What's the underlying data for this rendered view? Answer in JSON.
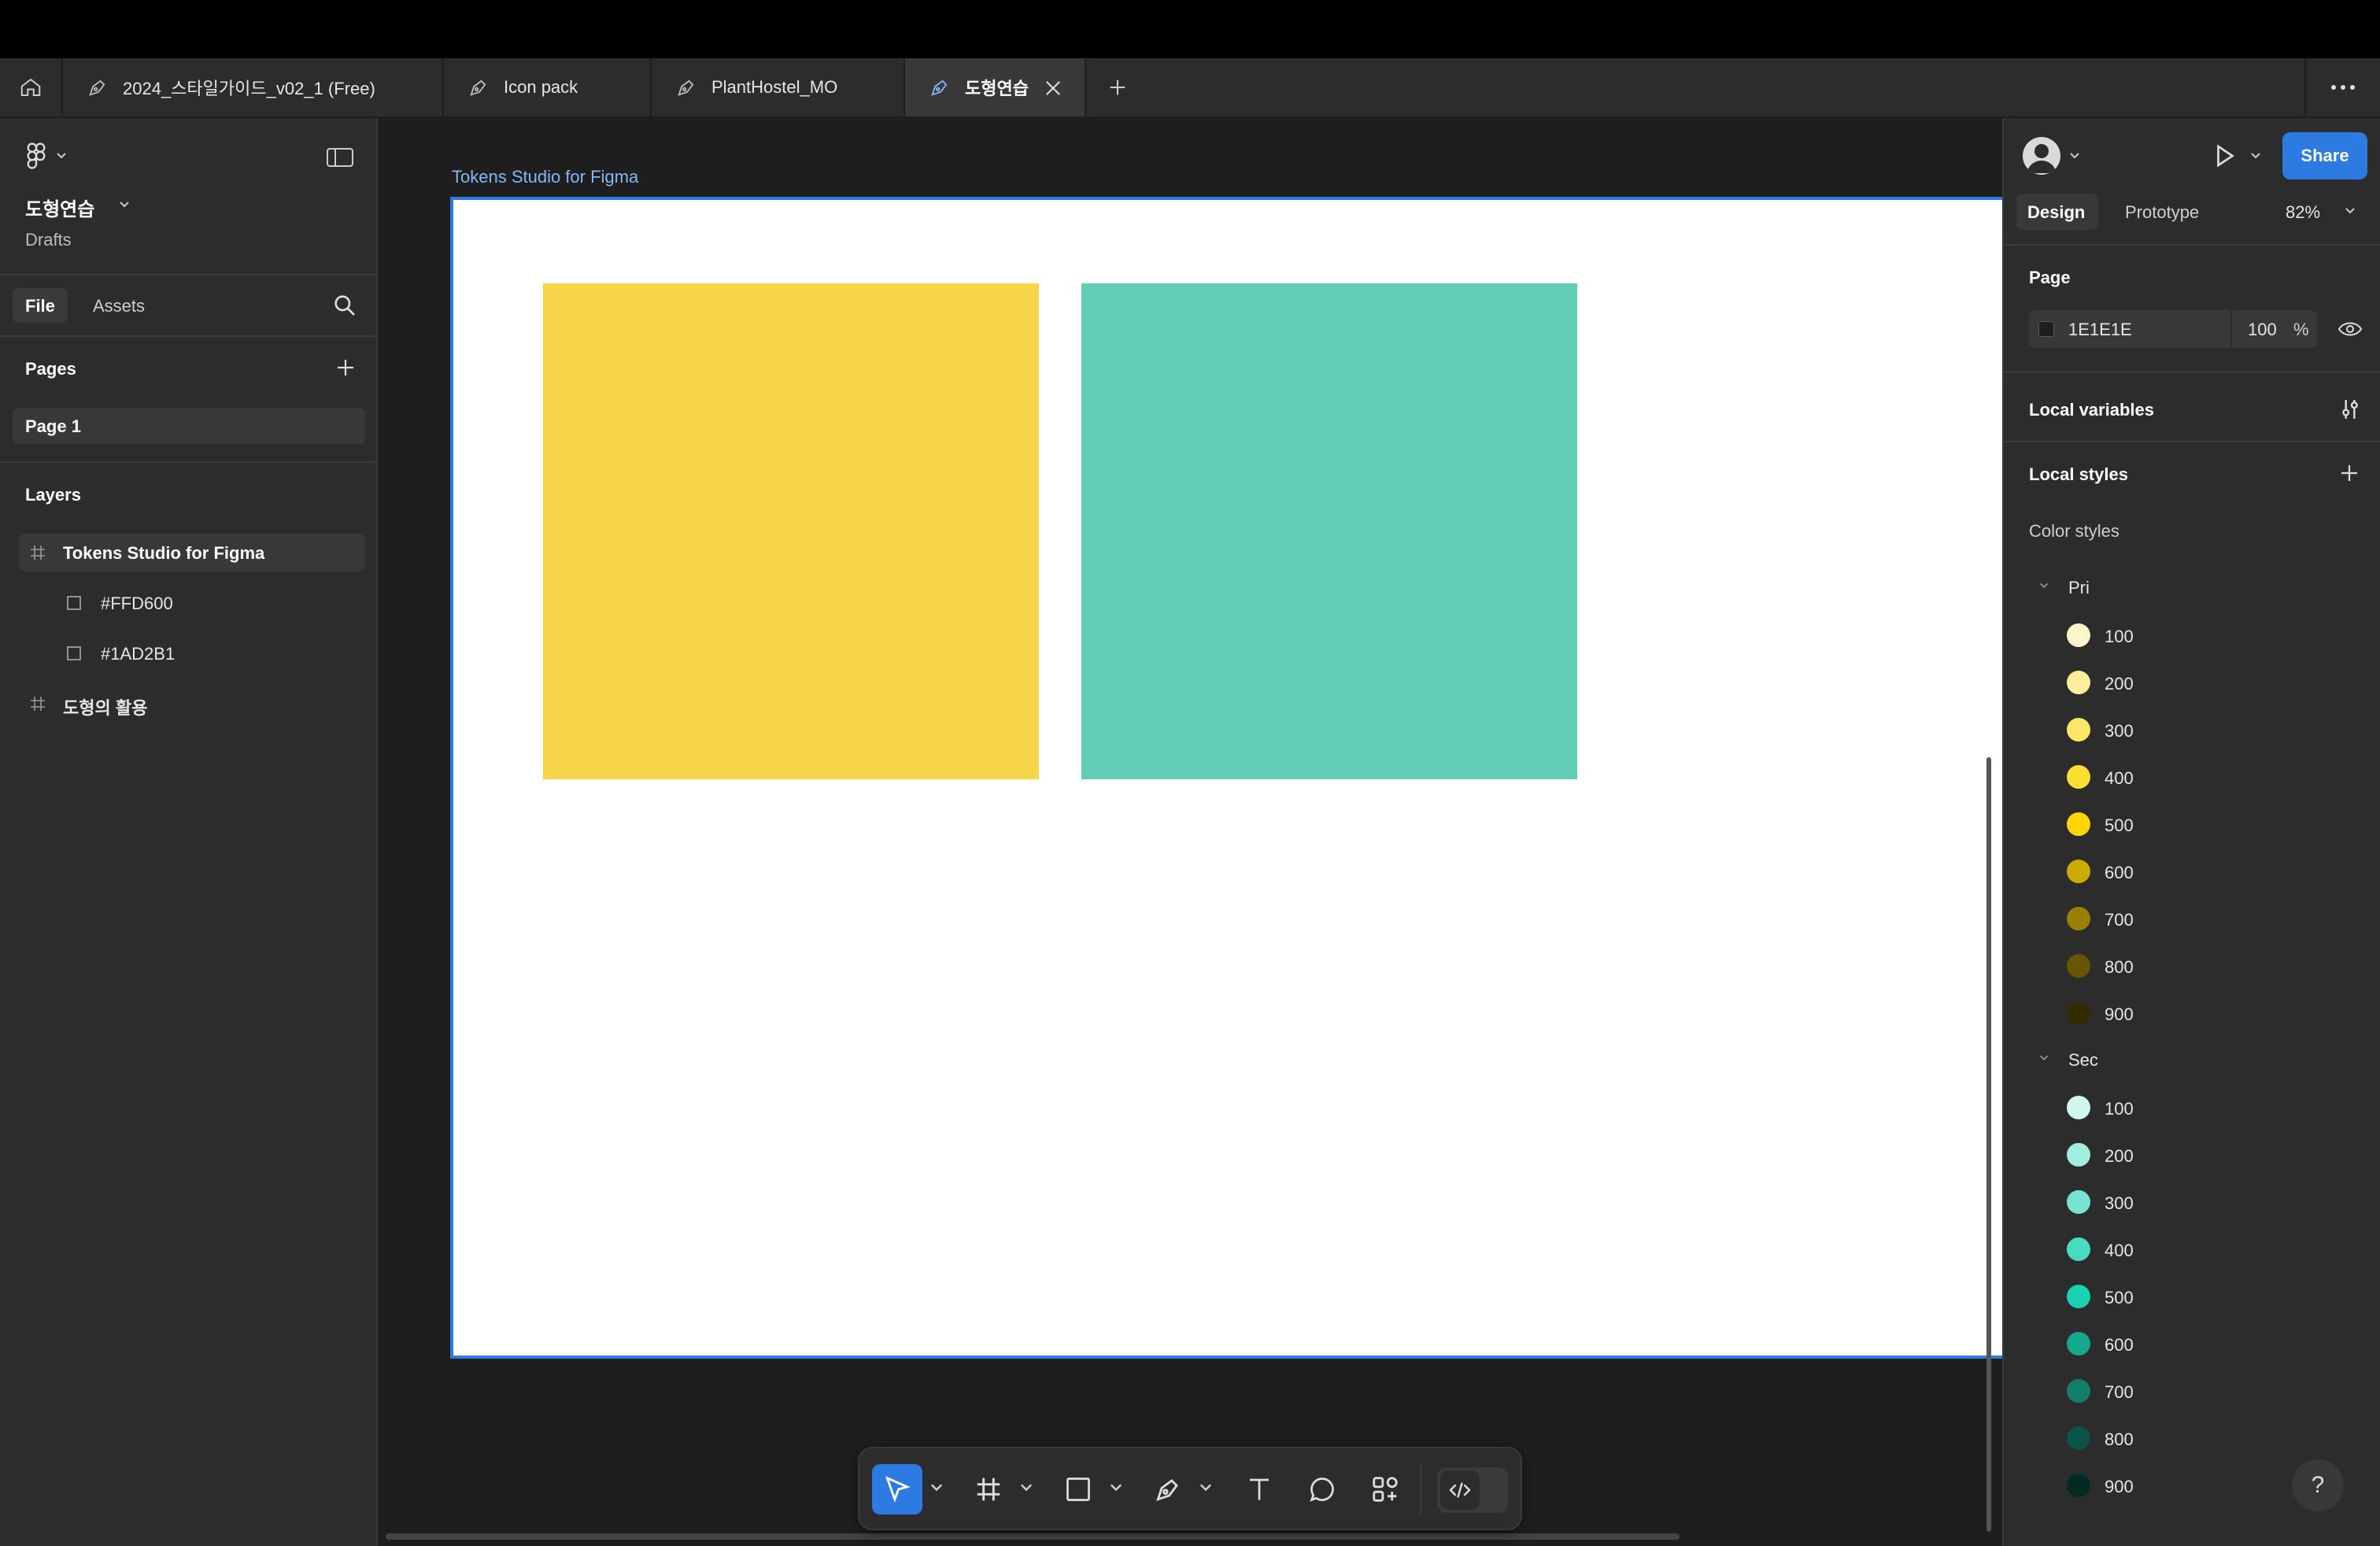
{
  "tabs": [
    {
      "label": "2024_스타일가이드_v02_1 (Free)",
      "active": false
    },
    {
      "label": "Icon pack",
      "active": false
    },
    {
      "label": "PlantHostel_MO",
      "active": false
    },
    {
      "label": "도형연습",
      "active": true
    }
  ],
  "left_panel": {
    "file_name": "도형연습",
    "location": "Drafts",
    "tabs": {
      "file": "File",
      "assets": "Assets"
    },
    "pages_header": "Pages",
    "pages": [
      "Page 1"
    ],
    "layers_header": "Layers",
    "layers": {
      "frame": "Tokens Studio for Figma",
      "child_1": "#FFD600",
      "child_2": "#1AD2B1",
      "frame_2": "도형의 활용"
    }
  },
  "canvas": {
    "frame_label": "Tokens Studio for Figma",
    "background": "#1e1e1e",
    "swatch_colors": [
      "#f7d54a",
      "#62cdb4"
    ]
  },
  "right_panel": {
    "tabs": {
      "design": "Design",
      "prototype": "Prototype"
    },
    "zoom": "82%",
    "share_label": "Share",
    "page_header": "Page",
    "page_color": "1E1E1E",
    "page_opacity": "100",
    "opacity_unit": "%",
    "local_variables": "Local variables",
    "local_styles": "Local styles",
    "color_styles": "Color styles",
    "groups": [
      {
        "name": "Pri",
        "styles": [
          {
            "label": "100",
            "color": "#fff5cc"
          },
          {
            "label": "200",
            "color": "#ffee99"
          },
          {
            "label": "300",
            "color": "#ffe666"
          },
          {
            "label": "400",
            "color": "#ffde33"
          },
          {
            "label": "500",
            "color": "#ffd600"
          },
          {
            "label": "600",
            "color": "#ccab00"
          },
          {
            "label": "700",
            "color": "#998000"
          },
          {
            "label": "800",
            "color": "#665600"
          },
          {
            "label": "900",
            "color": "#332b00"
          }
        ]
      },
      {
        "name": "Sec",
        "styles": [
          {
            "label": "100",
            "color": "#d1f6ef"
          },
          {
            "label": "200",
            "color": "#a3ede0"
          },
          {
            "label": "300",
            "color": "#76e4d0"
          },
          {
            "label": "400",
            "color": "#48dbc1"
          },
          {
            "label": "500",
            "color": "#1ad2b1"
          },
          {
            "label": "600",
            "color": "#15a88e"
          },
          {
            "label": "700",
            "color": "#107e6a"
          },
          {
            "label": "800",
            "color": "#0a5447"
          },
          {
            "label": "900",
            "color": "#052a23"
          }
        ]
      }
    ]
  },
  "accent": "#2d7be2"
}
